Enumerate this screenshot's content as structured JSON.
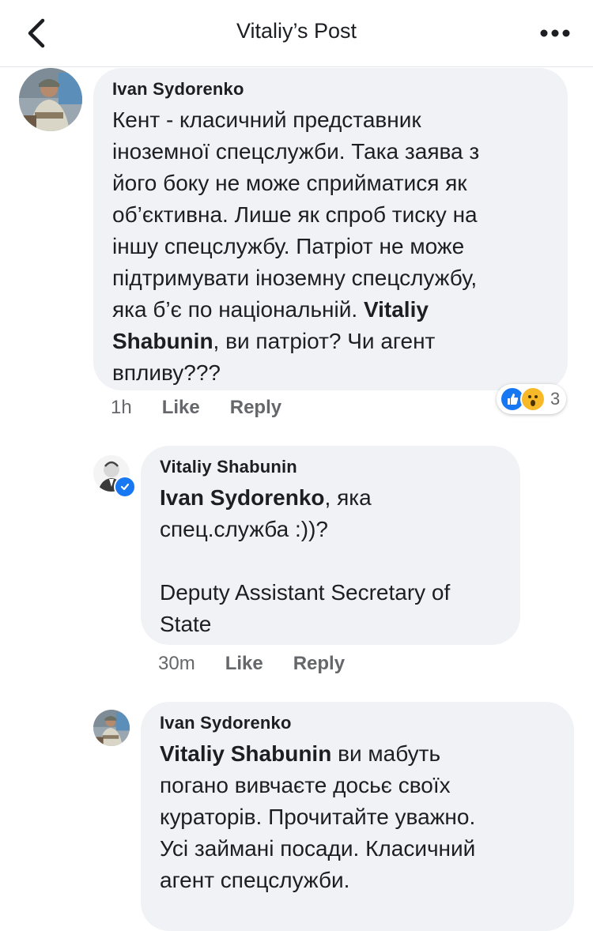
{
  "header": {
    "title": "Vitaliy’s Post",
    "back_icon": "chevron-left-icon",
    "more_icon": "more-horizontal-icon"
  },
  "comments": [
    {
      "author": "Ivan Sydorenko",
      "text_before": "Кент - класичний представник\nіноземної спецслужби. Така заява з\nйого боку не може сприйматися як\nоб’єктивна. Лише як спроб тиску на\nіншу спецслужбу. Патріот не може\nпідтримувати іноземну спецслужбу,\nяка б’є по національній. ",
      "mention": "Vitaliy\nShabunin",
      "text_after": ", ви патріот? Чи агент\nвпливу???",
      "time": "1h",
      "like_label": "Like",
      "reply_label": "Reply",
      "reactions": {
        "icons": [
          "like",
          "wow"
        ],
        "count": "3"
      }
    },
    {
      "author": "Vitaliy Shabunin",
      "mention": "Ivan Sydorenko",
      "text_after": ", яка\nспец.служба :))?\n\nDeputy Assistant Secretary of\nState",
      "time": "30m",
      "like_label": "Like",
      "reply_label": "Reply",
      "verified": true
    },
    {
      "author": "Ivan Sydorenko",
      "mention": "Vitaliy Shabunin",
      "text_after": " ви мабуть\nпогано вивчаєте досьє своїх\nкураторів. Прочитайте уважно.\nУсі займані посади. Класичний\nагент спецслужби."
    }
  ],
  "colors": {
    "bubble_bg": "#f0f2f5",
    "meta_text": "#65676b",
    "like_blue": "#1877f2",
    "wow_yellow": "#f7b928"
  }
}
